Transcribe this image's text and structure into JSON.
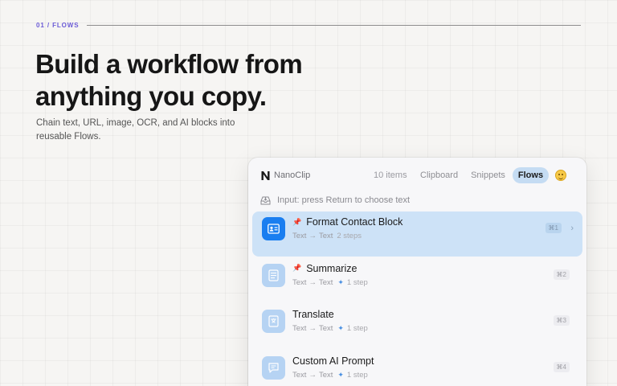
{
  "eyebrow": "01 / FLOWS",
  "headline": "Build a workflow from anything you copy.",
  "subhead": "Chain text, URL, image, OCR, and AI blocks into reusable Flows.",
  "window": {
    "app_name": "NanoClip",
    "item_count": "10 items",
    "tabs": [
      {
        "label": "Clipboard",
        "active": false
      },
      {
        "label": "Snippets",
        "active": false
      },
      {
        "label": "Flows",
        "active": true
      }
    ],
    "input_hint": "Input: press Return to choose text",
    "flows": [
      {
        "title": "Format Contact Block",
        "pinned": true,
        "from": "Text",
        "to": "Text",
        "ai": false,
        "steps": "2 steps",
        "shortcut": "⌘1",
        "selected": true,
        "icon": "contact-card-icon"
      },
      {
        "title": "Summarize",
        "pinned": true,
        "from": "Text",
        "to": "Text",
        "ai": true,
        "steps": "1 step",
        "shortcut": "⌘2",
        "selected": false,
        "icon": "document-lines-icon"
      },
      {
        "title": "Translate",
        "pinned": false,
        "from": "Text",
        "to": "Text",
        "ai": true,
        "steps": "1 step",
        "shortcut": "⌘3",
        "selected": false,
        "icon": "translate-doc-icon"
      },
      {
        "title": "Custom AI Prompt",
        "pinned": false,
        "from": "Text",
        "to": "Text",
        "ai": true,
        "steps": "1 step",
        "shortcut": "⌘4",
        "selected": false,
        "icon": "chat-bubble-icon"
      }
    ],
    "colors": {
      "accent": "#1a7ef0",
      "selected_row": "#cde2f7",
      "eyebrow": "#6b5bd6"
    }
  }
}
